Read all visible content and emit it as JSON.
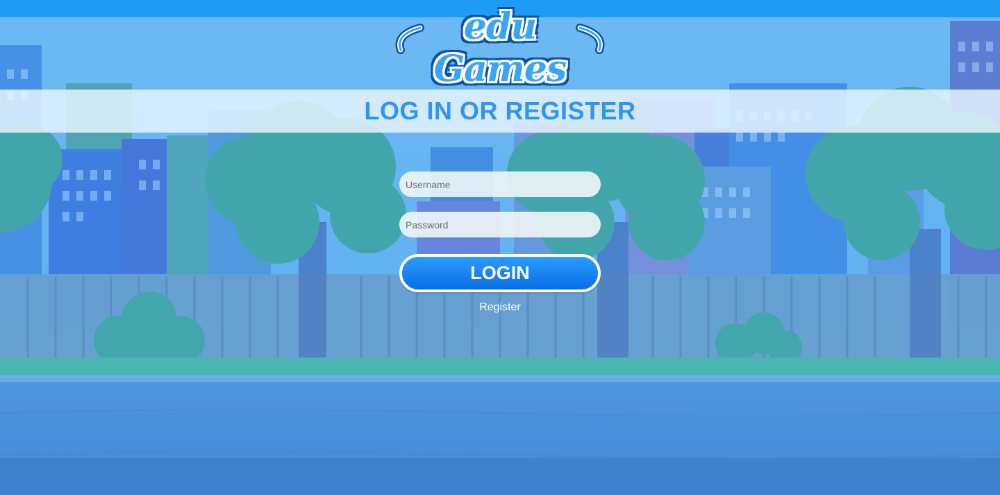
{
  "logo": {
    "text": "edu Games"
  },
  "header": {
    "title": "LOG IN OR REGISTER"
  },
  "form": {
    "username_placeholder": "Username",
    "password_placeholder": "Password",
    "login_label": "LOGIN",
    "register_label": "Register"
  },
  "colors": {
    "topbar": "#1e9bf5",
    "title": "#2f95ee",
    "button": "#0a6ee6"
  }
}
